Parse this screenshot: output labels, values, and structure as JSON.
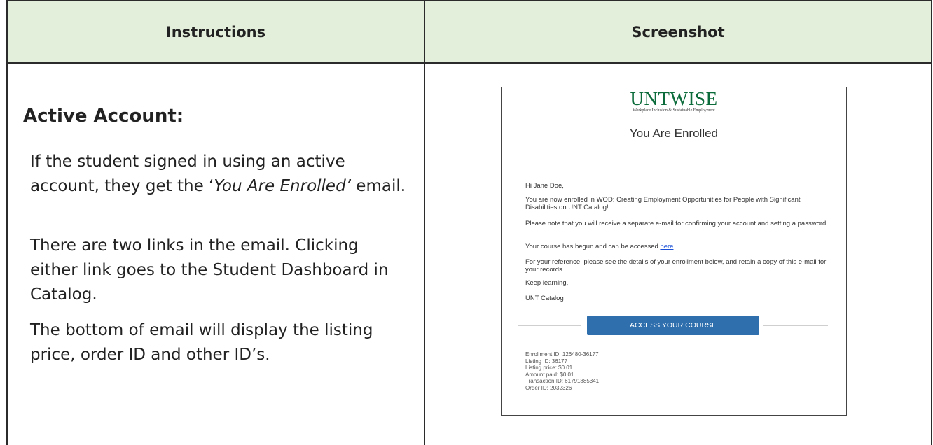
{
  "table": {
    "col1_header": "Instructions",
    "col2_header": "Screenshot"
  },
  "instructions": {
    "title": "Active Account:",
    "p1_before": "If the student signed in using an active account, they get the ‘",
    "p1_italic": "You Are Enrolled’",
    "p1_after": " email.",
    "p2": "There are two links in the email. Clicking either link goes to the Student Dashboard in Catalog.",
    "p3": "The bottom of email will display the listing price, order ID and other ID’s."
  },
  "email": {
    "logo": "UNTWISE",
    "logo_tagline": "Workplace Inclusion & Sustainable Employment",
    "title": "You Are Enrolled",
    "greeting": "Hi Jane Doe,",
    "enrolled_text": "You are now enrolled in WOD: Creating Employment Opportunities for People with Significant Disabilities on UNT Catalog!",
    "separate_email_text": "Please note that you will receive a separate e-mail for confirming your account and setting a password.",
    "access_text": "Your course has begun and can be accessed ",
    "access_link": "here",
    "access_end": ".",
    "reference_text": "For your reference, please see the details of your enrollment below, and retain a copy of this e-mail for your records.",
    "signoff": "Keep learning,",
    "signature": "UNT Catalog",
    "button_label": "ACCESS YOUR COURSE",
    "details": [
      "Enrollment ID: 126480-36177",
      "Listing ID: 36177",
      "Listing price: $0.01",
      "Amount paid: $0.01",
      "Transaction ID: 61791885341",
      "Order ID: 2032326"
    ]
  }
}
